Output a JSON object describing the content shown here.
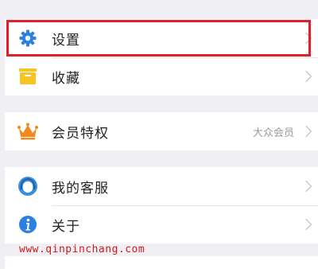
{
  "menu": {
    "settings": {
      "label": "设置",
      "icon": "gear-icon",
      "color": "#2d7fe0"
    },
    "favorites": {
      "label": "收藏",
      "icon": "folder-icon",
      "color": "#f6c423"
    },
    "vip": {
      "label": "会员特权",
      "icon": "crown-icon",
      "color": "#f08a1c",
      "value": "大众会员"
    },
    "service": {
      "label": "我的客服",
      "icon": "headset-icon",
      "color": "#3a8fe0"
    },
    "about": {
      "label": "关于",
      "icon": "info-icon",
      "color": "#2d7fe0"
    }
  },
  "watermark": "www.qinpinchang.com",
  "colors": {
    "highlight": "#e0202b",
    "background": "#efeff4"
  }
}
